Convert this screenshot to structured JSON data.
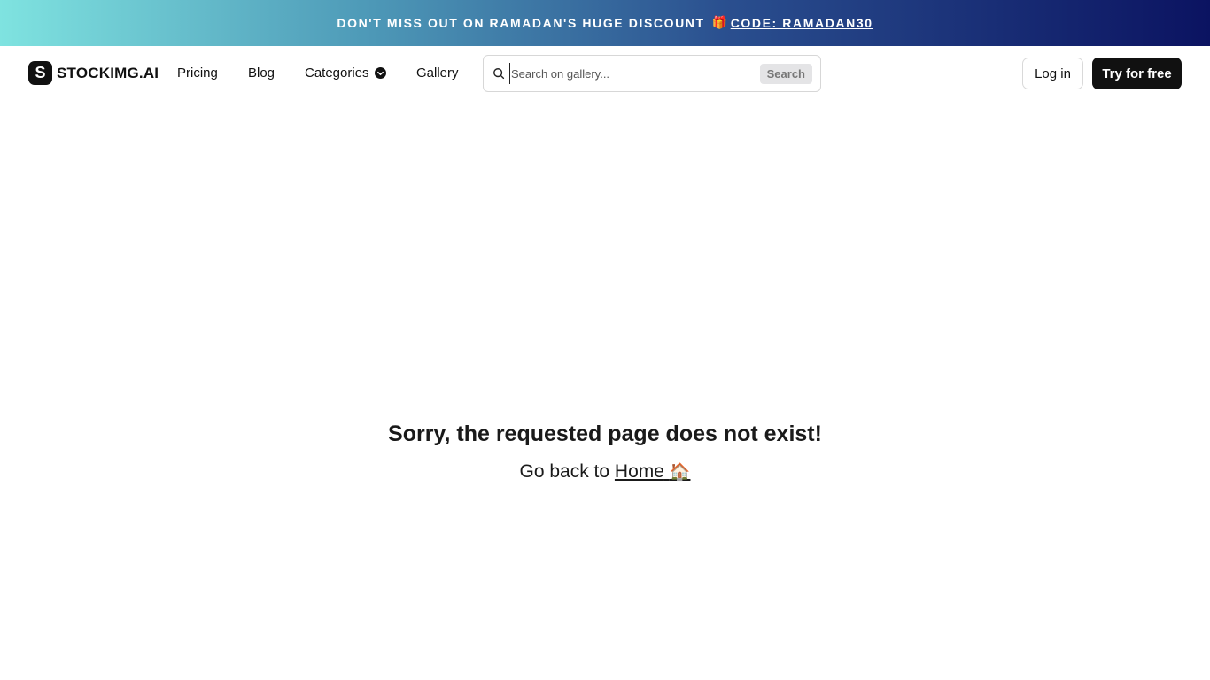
{
  "promo": {
    "text": "DON'T MISS OUT ON RAMADAN'S HUGE DISCOUNT",
    "gift_emoji": "🎁",
    "code": "CODE: RAMADAN30"
  },
  "nav": {
    "logo_letter": "S",
    "logo_text": "STOCKIMG.AI",
    "links": {
      "pricing": "Pricing",
      "blog": "Blog",
      "categories": "Categories",
      "gallery": "Gallery"
    },
    "search": {
      "placeholder": "Search on gallery...",
      "button": "Search"
    },
    "login": "Log in",
    "try": "Try for free"
  },
  "error": {
    "title": "Sorry, the requested page does not exist!",
    "back_prefix": "Go back to",
    "home_link": "Home",
    "home_emoji": "🏠"
  },
  "colors": {
    "primary": "#111111",
    "promo_gradient_start": "#7fe3e0",
    "promo_gradient_end": "#0b1361"
  }
}
